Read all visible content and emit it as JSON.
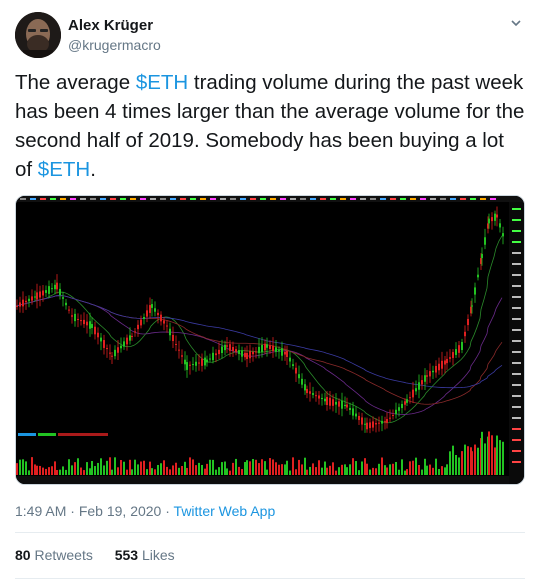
{
  "author": {
    "name": "Alex Krüger",
    "handle": "@krugermacro"
  },
  "tweet": {
    "text_1": "The average ",
    "cashtag_1": "$ETH",
    "text_2": " trading volume during the past week has been 4 times larger than the average volume for the second half of 2019. Somebody has been buying a lot of ",
    "cashtag_2": "$ETH",
    "text_3": "."
  },
  "meta": {
    "time": "1:49 AM",
    "separator": " · ",
    "date": "Feb 19, 2020",
    "app": "Twitter Web App"
  },
  "stats": {
    "retweets_count": "80",
    "retweets_label": "Retweets",
    "likes_count": "553",
    "likes_label": "Likes"
  },
  "colors": {
    "link": "#1b95e0",
    "secondary_text": "#657786",
    "candle_up": "#22c322",
    "candle_down": "#e02020"
  },
  "icons": {
    "caret": "chevron-down-icon"
  }
}
